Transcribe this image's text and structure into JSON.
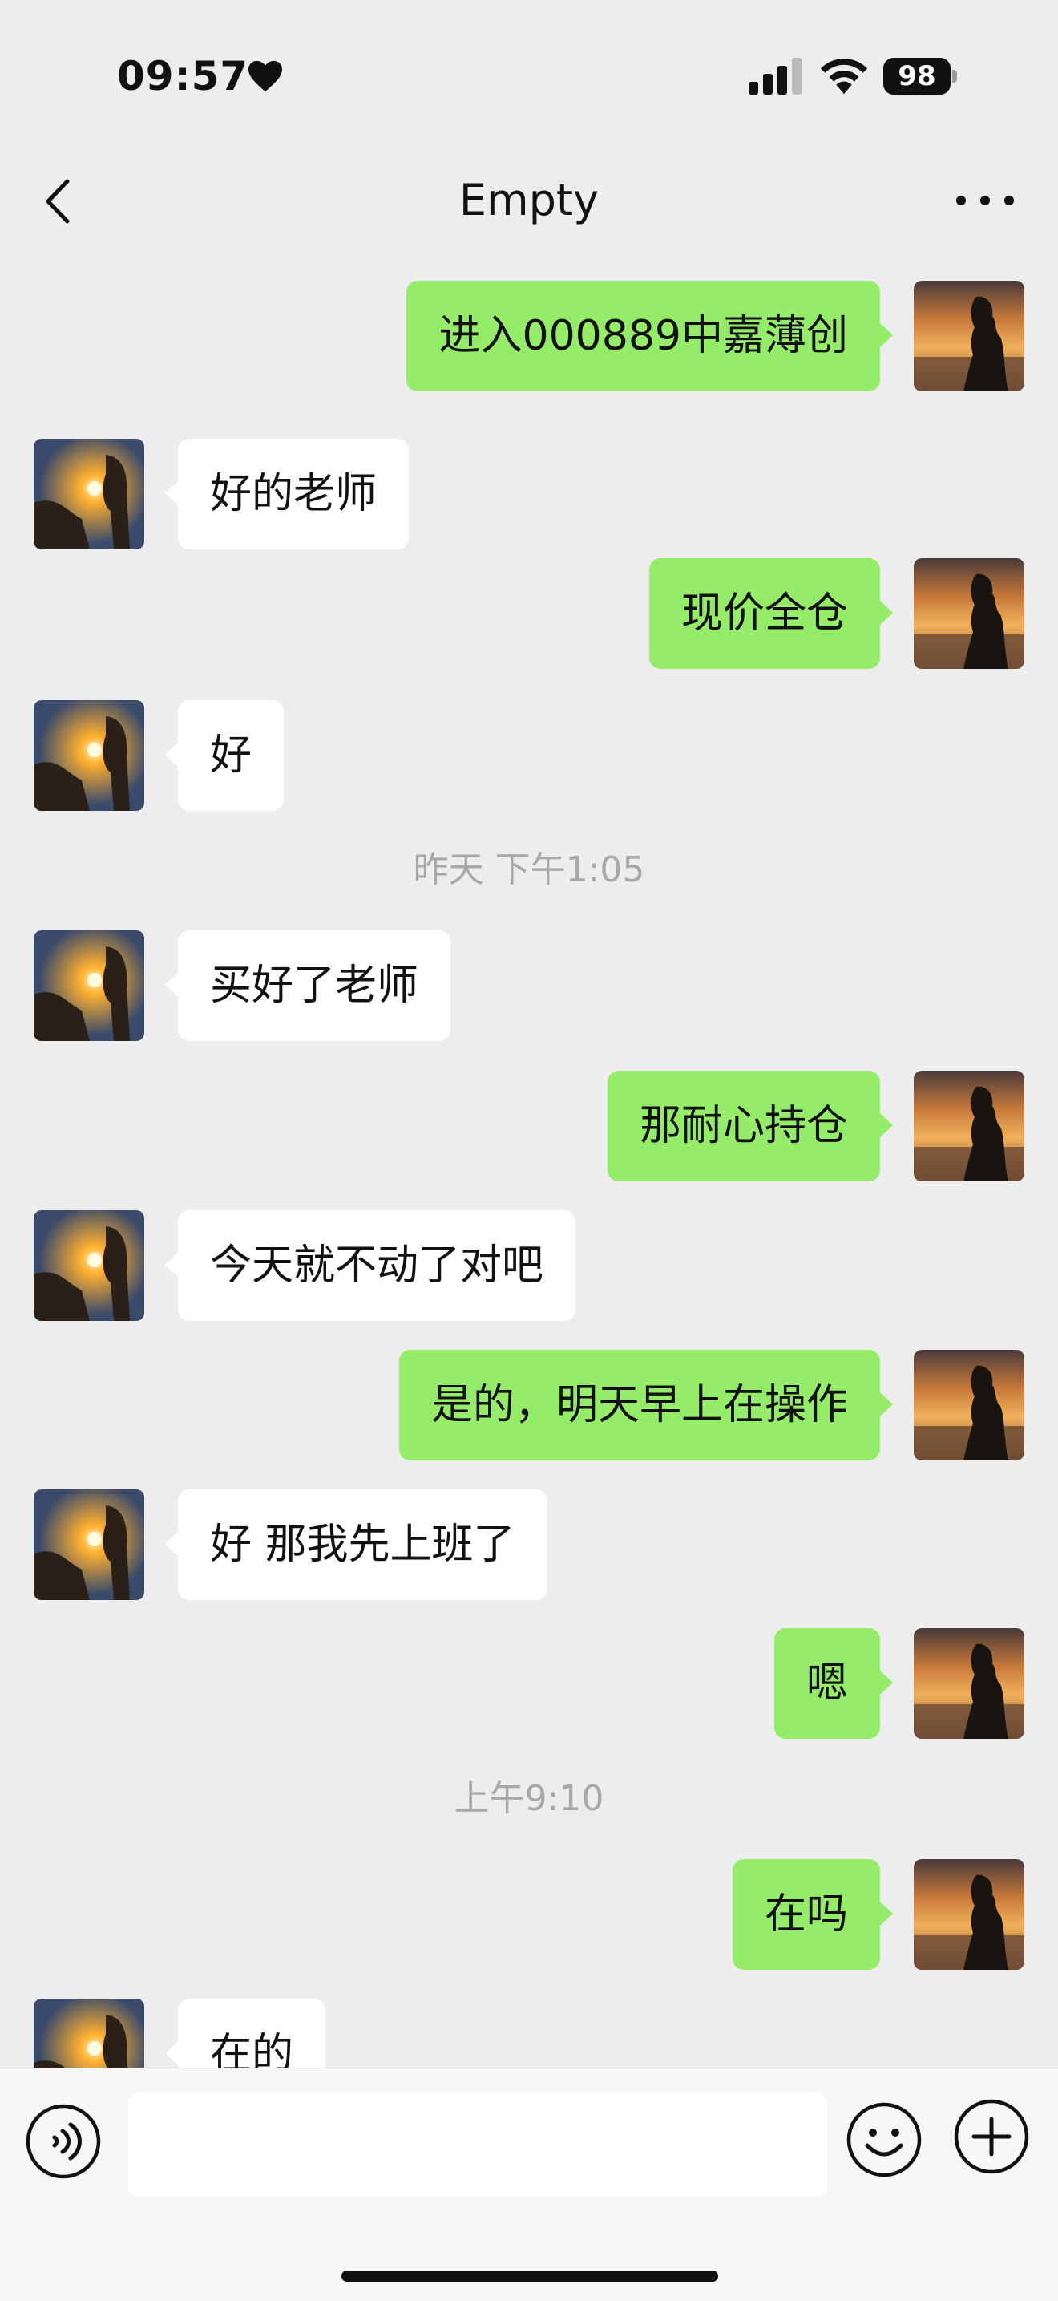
{
  "status_bar": {
    "time": "09:57",
    "battery": "98"
  },
  "header": {
    "title": "Empty"
  },
  "input": {
    "placeholder": ""
  },
  "messages": [
    {
      "side": "out",
      "text": "进入000889中嘉薄创"
    },
    {
      "side": "in",
      "text": "好的老师"
    },
    {
      "side": "out",
      "text": "现价全仓"
    },
    {
      "side": "in",
      "text": "好"
    },
    {
      "type": "time",
      "text": "昨天  下午1:05"
    },
    {
      "side": "in",
      "text": "买好了老师"
    },
    {
      "side": "out",
      "text": "那耐心持仓"
    },
    {
      "side": "in",
      "text": "今天就不动了对吧"
    },
    {
      "side": "out",
      "text": "是的，明天早上在操作"
    },
    {
      "side": "in",
      "text": "好 那我先上班了"
    },
    {
      "side": "out",
      "text": "嗯"
    },
    {
      "type": "time",
      "text": "上午9:10"
    },
    {
      "side": "out",
      "text": "在吗"
    },
    {
      "side": "in",
      "text": "在的"
    }
  ],
  "icons": {
    "back": "chevron-left-icon",
    "more": "more-dots-icon",
    "voice": "voice-icon",
    "emoji": "emoji-icon",
    "plus": "plus-icon"
  },
  "colors": {
    "outgoing_bubble": "#95ec69",
    "incoming_bubble": "#ffffff",
    "background": "#ededed"
  }
}
